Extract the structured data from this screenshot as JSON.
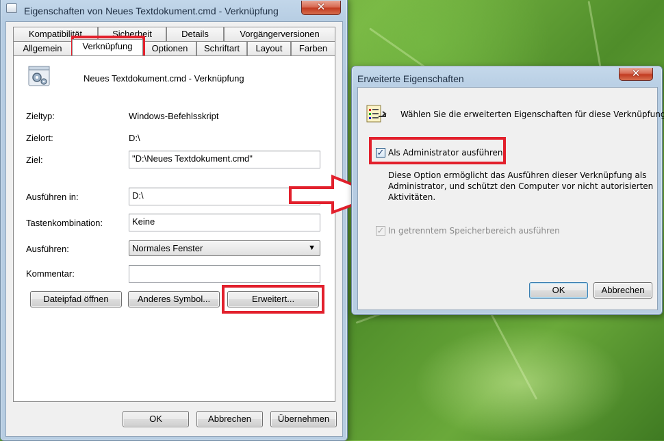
{
  "main_window": {
    "title": "Eigenschaften von Neues Textdokument.cmd - Verknüpfung",
    "tabs_row1": [
      "Kompatibilität",
      "Sicherheit",
      "Details",
      "Vorgängerversionen"
    ],
    "tabs_row2": [
      "Allgemein",
      "Verknüpfung",
      "Optionen",
      "Schriftart",
      "Layout",
      "Farben"
    ],
    "shortcut_name": "Neues Textdokument.cmd - Verknüpfung",
    "fields": {
      "target_type_label": "Zieltyp:",
      "target_type_value": "Windows-Befehlsskript",
      "target_location_label": "Zielort:",
      "target_location_value": "D:\\",
      "target_label": "Ziel:",
      "target_value": "\"D:\\Neues Textdokument.cmd\"",
      "start_in_label": "Ausführen in:",
      "start_in_value": "D:\\",
      "hotkey_label": "Tastenkombination:",
      "hotkey_value": "Keine",
      "run_label": "Ausführen:",
      "run_value": "Normales Fenster",
      "comment_label": "Kommentar:",
      "comment_value": ""
    },
    "buttons": {
      "open_location": "Dateipfad öffnen",
      "change_icon": "Anderes Symbol...",
      "advanced": "Erweitert...",
      "ok": "OK",
      "cancel": "Abbrechen",
      "apply": "Übernehmen"
    }
  },
  "advanced_dialog": {
    "title": "Erweiterte Eigenschaften",
    "intro": "Wählen Sie die erweiterten Eigenschaften für diese Verknüpfung.",
    "run_as_admin_label": "Als Administrator ausführen",
    "run_as_admin_checked": true,
    "description_lines": [
      "Diese Option ermöglicht das Ausführen dieser Verknüpfung als",
      "Administrator, und schützt den Computer vor nicht autorisierten",
      "Aktivitäten."
    ],
    "separate_memory_label": "In getrenntem Speicherbereich ausführen",
    "separate_memory_checked": true,
    "separate_memory_disabled": true,
    "ok": "OK",
    "cancel": "Abbrechen"
  },
  "icons": {
    "close": "close-icon",
    "shortcut_gear": "gear-document-icon",
    "properties_list": "properties-list-icon",
    "dropdown": "chevron-down-icon",
    "arrow": "right-arrow-annotation"
  },
  "colors": {
    "highlight_red": "#e2202c",
    "close_button": "#c23b21",
    "window_frame": "#b5cce2"
  }
}
